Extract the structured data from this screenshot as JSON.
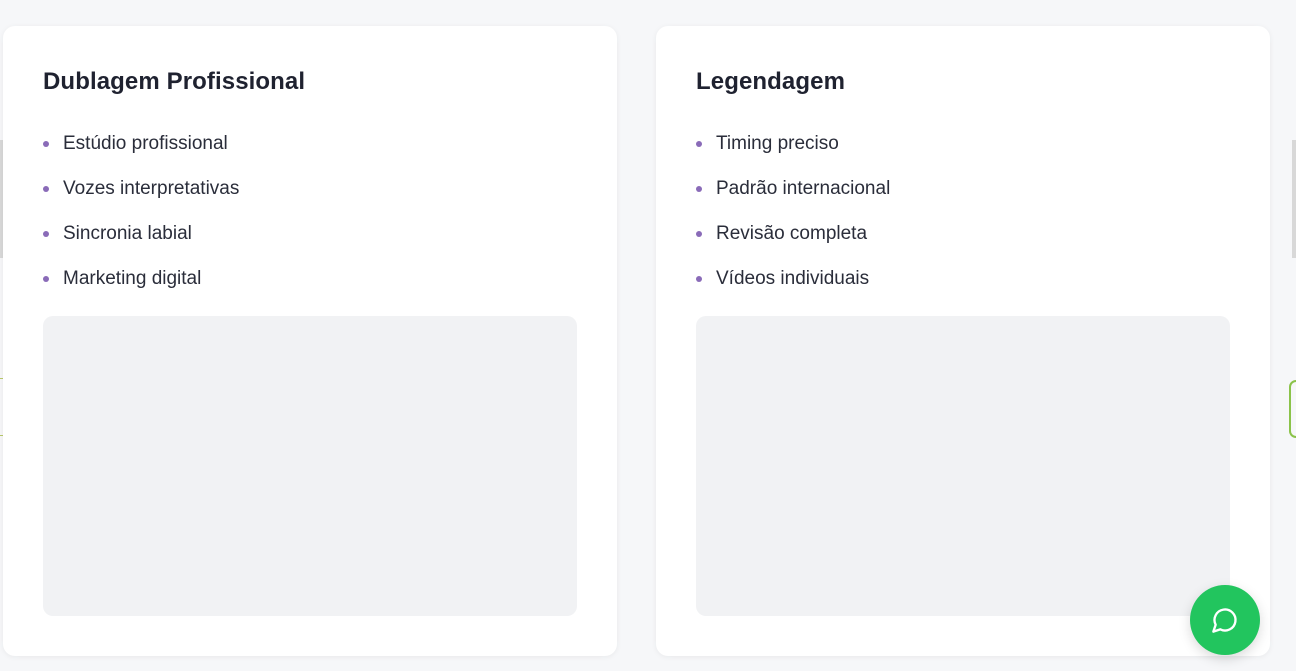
{
  "cards": [
    {
      "title": "Dublagem Profissional",
      "features": [
        "Estúdio profissional",
        "Vozes interpretativas",
        "Sincronia labial",
        "Marketing digital"
      ]
    },
    {
      "title": "Legendagem",
      "features": [
        "Timing preciso",
        "Padrão internacional",
        "Revisão completa",
        "Vídeos individuais"
      ]
    }
  ],
  "chat_button": {
    "icon": "chat-bubble-icon",
    "color": "#22c55e"
  },
  "colors": {
    "bullet": "#8a6bb8",
    "placeholder": "#f1f2f4",
    "background": "#f6f7f9"
  }
}
